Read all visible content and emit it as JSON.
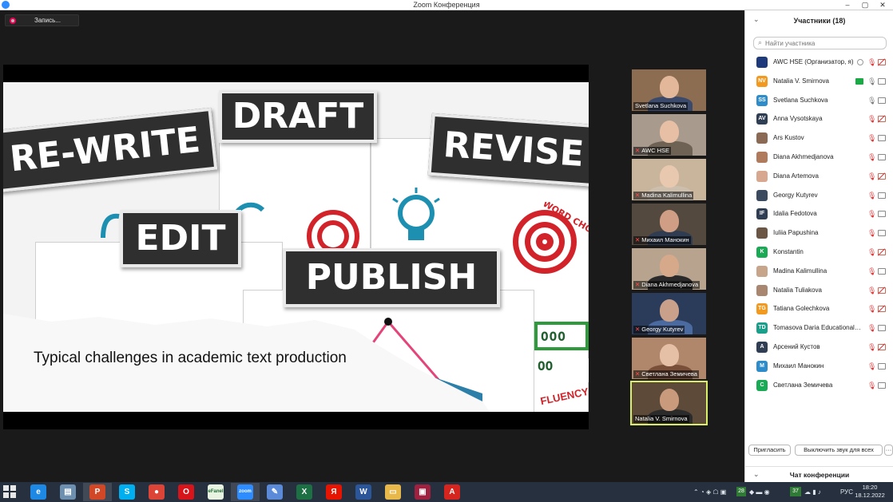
{
  "window": {
    "title": "Zoom Конференция",
    "buttons": [
      "–",
      "▢",
      "✕"
    ]
  },
  "recording": {
    "label": "Запись..."
  },
  "slide": {
    "banners": [
      "DRAFT",
      "RE-WRITE",
      "REVISE",
      "EDIT",
      "PUBLISH"
    ],
    "caption": "Typical challenges in academic text production",
    "decor_texts": [
      "WORD CHOICE",
      "FLUENCY"
    ]
  },
  "thumbnails": [
    {
      "name": "Svetlana Suchkova",
      "muted": false,
      "bg": "#8c6d52",
      "shirt": "#3b4a6b",
      "skin": "#e3b79a"
    },
    {
      "name": "AWC HSE",
      "muted": true,
      "bg": "#a89a8c",
      "shirt": "#6e6255",
      "skin": "#e6bfa5"
    },
    {
      "name": "Madina Kalimullina",
      "muted": true,
      "bg": "#c9b49c",
      "shirt": "#cdbfae",
      "skin": "#e8c9b0"
    },
    {
      "name": "Михаил Манокин",
      "muted": true,
      "bg": "#54493f",
      "shirt": "#2f3c52",
      "skin": "#cf9e84"
    },
    {
      "name": "Diana Akhmedjanova",
      "muted": true,
      "bg": "#b8a48e",
      "shirt": "#2a2a2a",
      "skin": "#d6a98b"
    },
    {
      "name": "Georgy Kutyrev",
      "muted": true,
      "bg": "#2b3b5a",
      "shirt": "#4a6aa0",
      "skin": "#c9a08a"
    },
    {
      "name": "Светлана Земичева",
      "muted": true,
      "bg": "#b0876a",
      "shirt": "#7a4f3a",
      "skin": "#e6c0a6"
    },
    {
      "name": "Natalia V. Smirnova",
      "muted": false,
      "bg": "#5d4a38",
      "shirt": "#2b2b2b",
      "skin": "#c99a7c",
      "active": true
    }
  ],
  "panel": {
    "title": "Участники (18)",
    "search_placeholder": "Найти участника",
    "participants": [
      {
        "name": "AWC HSE (Организатор, я)",
        "initials": "",
        "color": "#1f3a7a",
        "mic": "muted",
        "cam": "off",
        "extra": "rec"
      },
      {
        "name": "Natalia V. Smirnova",
        "initials": "NV",
        "color": "#f29a1f",
        "mic": "on",
        "cam": "on",
        "extra": "share"
      },
      {
        "name": "Svetlana Suchkova",
        "initials": "SS",
        "color": "#2d8cc9",
        "mic": "on",
        "cam": "on",
        "extra": ""
      },
      {
        "name": "Anna Vysotskaya",
        "initials": "AV",
        "color": "#2f3e52",
        "mic": "muted",
        "cam": "off",
        "extra": ""
      },
      {
        "name": "Ars Kustov",
        "initials": "",
        "color": "#8a6a55",
        "mic": "muted",
        "cam": "on",
        "extra": ""
      },
      {
        "name": "Diana Akhmedjanova",
        "initials": "",
        "color": "#b07a5c",
        "mic": "muted",
        "cam": "on",
        "extra": ""
      },
      {
        "name": "Diana Artemova",
        "initials": "",
        "color": "#d7a88f",
        "mic": "muted",
        "cam": "off",
        "extra": ""
      },
      {
        "name": "Georgy Kutyrev",
        "initials": "",
        "color": "#3b4a5e",
        "mic": "muted",
        "cam": "on",
        "extra": ""
      },
      {
        "name": "Idalia Fedotova",
        "initials": "IF",
        "color": "#2f3e52",
        "mic": "muted",
        "cam": "on",
        "extra": ""
      },
      {
        "name": "Iuliia Papushina",
        "initials": "",
        "color": "#6b5646",
        "mic": "muted",
        "cam": "on",
        "extra": ""
      },
      {
        "name": "Konstantin",
        "initials": "K",
        "color": "#1aaa55",
        "mic": "muted",
        "cam": "off",
        "extra": ""
      },
      {
        "name": "Madina Kalimullina",
        "initials": "",
        "color": "#c7a58b",
        "mic": "muted",
        "cam": "on",
        "extra": ""
      },
      {
        "name": "Natalia Tuliakova",
        "initials": "",
        "color": "#a88670",
        "mic": "muted",
        "cam": "off",
        "extra": ""
      },
      {
        "name": "Tatiana Golechkova",
        "initials": "TG",
        "color": "#f29a1f",
        "mic": "muted",
        "cam": "off",
        "extra": ""
      },
      {
        "name": "Tomasova Daria Educational sci...",
        "initials": "TD",
        "color": "#1aa08a",
        "mic": "muted",
        "cam": "on",
        "extra": ""
      },
      {
        "name": "Арсений Кустов",
        "initials": "А",
        "color": "#2f3e52",
        "mic": "muted",
        "cam": "off",
        "extra": ""
      },
      {
        "name": "Михаил Манокин",
        "initials": "М",
        "color": "#2d8cc9",
        "mic": "muted",
        "cam": "on",
        "extra": ""
      },
      {
        "name": "Светлана Земичева",
        "initials": "С",
        "color": "#1aaa55",
        "mic": "muted",
        "cam": "on",
        "extra": ""
      }
    ],
    "invite_label": "Пригласить",
    "mute_all_label": "Выключить звук для всех",
    "more_label": "···",
    "chat_label": "Чат конференции"
  },
  "taskbar": {
    "apps": [
      {
        "icon": "ie-icon",
        "glyph": "e",
        "color": "#1e88e5"
      },
      {
        "icon": "file-manager-icon",
        "glyph": "▤",
        "color": "#6d8fb0"
      },
      {
        "icon": "powerpoint-icon",
        "glyph": "P",
        "color": "#d24726",
        "active": true
      },
      {
        "icon": "skype-icon",
        "glyph": "S",
        "color": "#00aff0"
      },
      {
        "icon": "chrome-icon",
        "glyph": "●",
        "color": "#db4437"
      },
      {
        "icon": "opera-icon",
        "glyph": "O",
        "color": "#d8141b"
      },
      {
        "icon": "efanel-icon",
        "glyph": "eFanel",
        "color": "#e9f3e2"
      },
      {
        "icon": "zoom-icon",
        "glyph": "zoom",
        "color": "#2d8cff",
        "active": true
      },
      {
        "icon": "paint-icon",
        "glyph": "✎",
        "color": "#5b8ad9"
      },
      {
        "icon": "excel-icon",
        "glyph": "X",
        "color": "#1d7044"
      },
      {
        "icon": "yandex-icon",
        "glyph": "Я",
        "color": "#e61400"
      },
      {
        "icon": "word-icon",
        "glyph": "W",
        "color": "#2b579a"
      },
      {
        "icon": "folder-icon",
        "glyph": "▭",
        "color": "#e8b84a"
      },
      {
        "icon": "winrar-icon",
        "glyph": "▣",
        "color": "#a0213f"
      },
      {
        "icon": "pdf-icon",
        "glyph": "A",
        "color": "#d6251f"
      }
    ],
    "tray_number": "28",
    "tray_temp": "37",
    "lang": "РУС",
    "time": "18:20",
    "date": "18.12.2022"
  }
}
